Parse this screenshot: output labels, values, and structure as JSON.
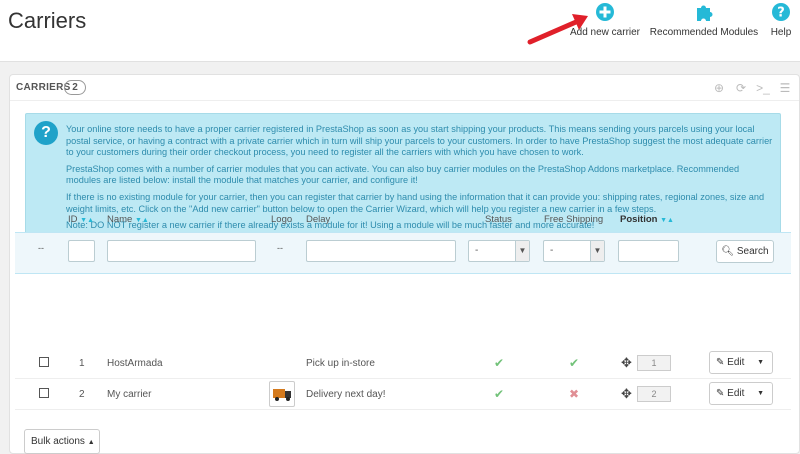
{
  "header": {
    "title": "Carriers",
    "toolbar": {
      "add": "Add new carrier",
      "recommended": "Recommended Modules",
      "help": "Help"
    }
  },
  "panel": {
    "title": "CARRIERS",
    "count": "2"
  },
  "info": {
    "paragraphs": [
      "Your online store needs to have a proper carrier registered in PrestaShop as soon as you start shipping your products. This means sending yours parcels using your local postal service, or having a contract with a private carrier which in turn will ship your parcels to your customers. In order to have PrestaShop suggest the most adequate carrier to your customers during their order checkout process, you need to register all the carriers with which you have chosen to work.",
      "PrestaShop comes with a number of carrier modules that you can activate. You can also buy carrier modules on the PrestaShop Addons marketplace. Recommended modules are listed below: install the module that matches your carrier, and configure it!",
      "If there is no existing module for your carrier, then you can register that carrier by hand using the information that it can provide you: shipping rates, regional zones, size and weight limits, etc. Click on the \"Add new carrier\" button below to open the Carrier Wizard, which will help you register a new carrier in a few steps.",
      "Note: DO NOT register a new carrier if there already exists a module for it! Using a module will be much faster and more accurate!"
    ]
  },
  "table": {
    "headers": {
      "id": "ID",
      "name": "Name",
      "logo": "Logo",
      "delay": "Delay",
      "status": "Status",
      "free_shipping": "Free Shipping",
      "position": "Position"
    },
    "filters": {
      "checkbox_placeholder": "--",
      "logo_placeholder": "--",
      "status_value": "-",
      "free_value": "-",
      "search": "Search"
    },
    "rows": [
      {
        "id": "1",
        "name": "HostArmada",
        "delay": "Pick up in-store",
        "status": "enabled",
        "free_shipping": "yes",
        "position": "1",
        "edit": "Edit"
      },
      {
        "id": "2",
        "name": "My carrier",
        "delay": "Delivery next day!",
        "status": "enabled",
        "free_shipping": "no",
        "position": "2",
        "edit": "Edit"
      }
    ],
    "bulk": "Bulk actions"
  },
  "colors": {
    "accent": "#25b9d7",
    "info_bg": "#bde9f4",
    "info_text": "#2e8cad",
    "success": "#72c279",
    "danger": "#e08f95",
    "arrow": "#e0202a"
  }
}
